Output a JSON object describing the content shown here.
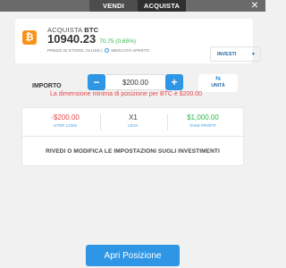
{
  "tabs": [
    {
      "label": "VENDI",
      "active": true
    },
    {
      "label": "ACQUISTA",
      "active": false
    }
  ],
  "close_icon": "close-icon",
  "instrument": {
    "logo_glyph": "₿",
    "logo_color": "#f7931a",
    "action": "ACQUISTA",
    "symbol": "BTC",
    "price": "10940.23",
    "change": "70.75 (0.65%)",
    "source_prefix": "PREZZI DI ETORO, IN USD |",
    "market_status": "MERCATO APERTO"
  },
  "invest_dropdown": {
    "label": "INVESTI",
    "icon": "chevron-down-icon"
  },
  "amount": {
    "label": "IMPORTO",
    "minus": "−",
    "plus": "+",
    "value": "$200.00",
    "unit_icon": "⇆",
    "unit_label": "UNITÀ",
    "warning": "La dimensione minima di posizione per BTC è $200.00"
  },
  "stats": {
    "stop_loss": {
      "value": "-$200.00",
      "label": "STOP LOSS"
    },
    "leverage": {
      "value": "X1",
      "label": "LEVA"
    },
    "take_profit": {
      "value": "$1,000.00",
      "label": "TAKE PROFIT"
    }
  },
  "review_link": "RIVEDI O MODIFICA LE IMPOSTAZIONI SUGLI INVESTIMENTI",
  "open_button": "Apri Posizione",
  "colors": {
    "accent": "#2f96e5",
    "positive": "#2db84d",
    "negative": "#e5474b",
    "topbar": "#6a6a6a"
  }
}
